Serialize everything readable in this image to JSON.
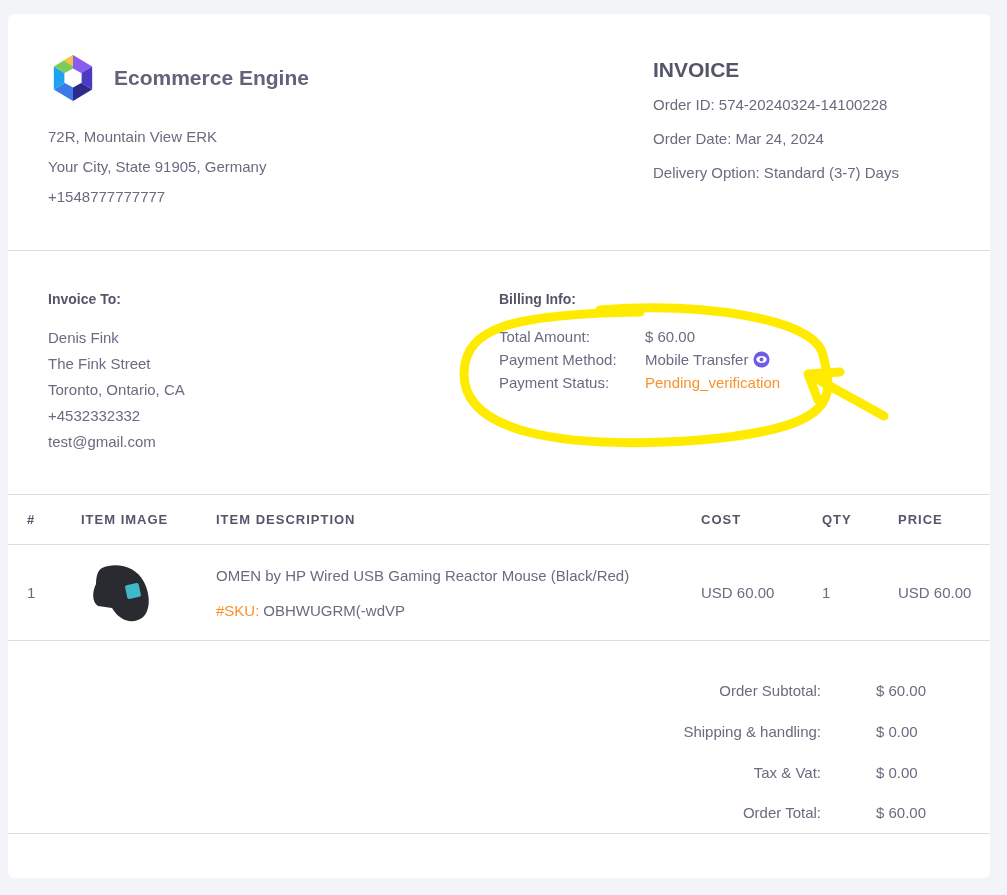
{
  "company": {
    "name": "Ecommerce Engine",
    "address_lines": [
      "72R, Mountain View ERK",
      "Your City, State 91905, Germany",
      "+1548777777777"
    ]
  },
  "invoice": {
    "title": "INVOICE",
    "lines": [
      "Order ID: 574-20240324-14100228",
      "Order Date: Mar 24, 2024",
      "Delivery Option: Standard (3-7) Days"
    ]
  },
  "invoice_to": {
    "heading": "Invoice To:",
    "lines": [
      "Denis Fink",
      "The Fink Street",
      "Toronto, Ontario, CA",
      "+4532332332",
      "test@gmail.com"
    ]
  },
  "billing": {
    "heading": "Billing Info:",
    "rows": [
      {
        "label": "Total Amount:",
        "value": "$ 60.00",
        "kind": "plain"
      },
      {
        "label": "Payment Method:",
        "value": "Mobile Transfer",
        "kind": "method"
      },
      {
        "label": "Payment Status:",
        "value": "Pending_verification",
        "kind": "status"
      }
    ]
  },
  "table": {
    "columns": [
      "#",
      "ITEM IMAGE",
      "ITEM DESCRIPTION",
      "COST",
      "QTY",
      "PRICE"
    ],
    "rows": [
      {
        "index": "1",
        "description": "OMEN by HP Wired USB Gaming Reactor Mouse (Black/Red)",
        "sku_label": "#SKU:",
        "sku_value": "OBHWUGRM(-wdVP",
        "cost": "USD 60.00",
        "qty": "1",
        "price": "USD 60.00"
      }
    ]
  },
  "totals": [
    {
      "label": "Order Subtotal:",
      "value": "$ 60.00"
    },
    {
      "label": "Shipping & handling:",
      "value": "$ 0.00"
    },
    {
      "label": "Tax & Vat:",
      "value": "$ 0.00"
    },
    {
      "label": "Order Total:",
      "value": "$ 60.00"
    }
  ]
}
